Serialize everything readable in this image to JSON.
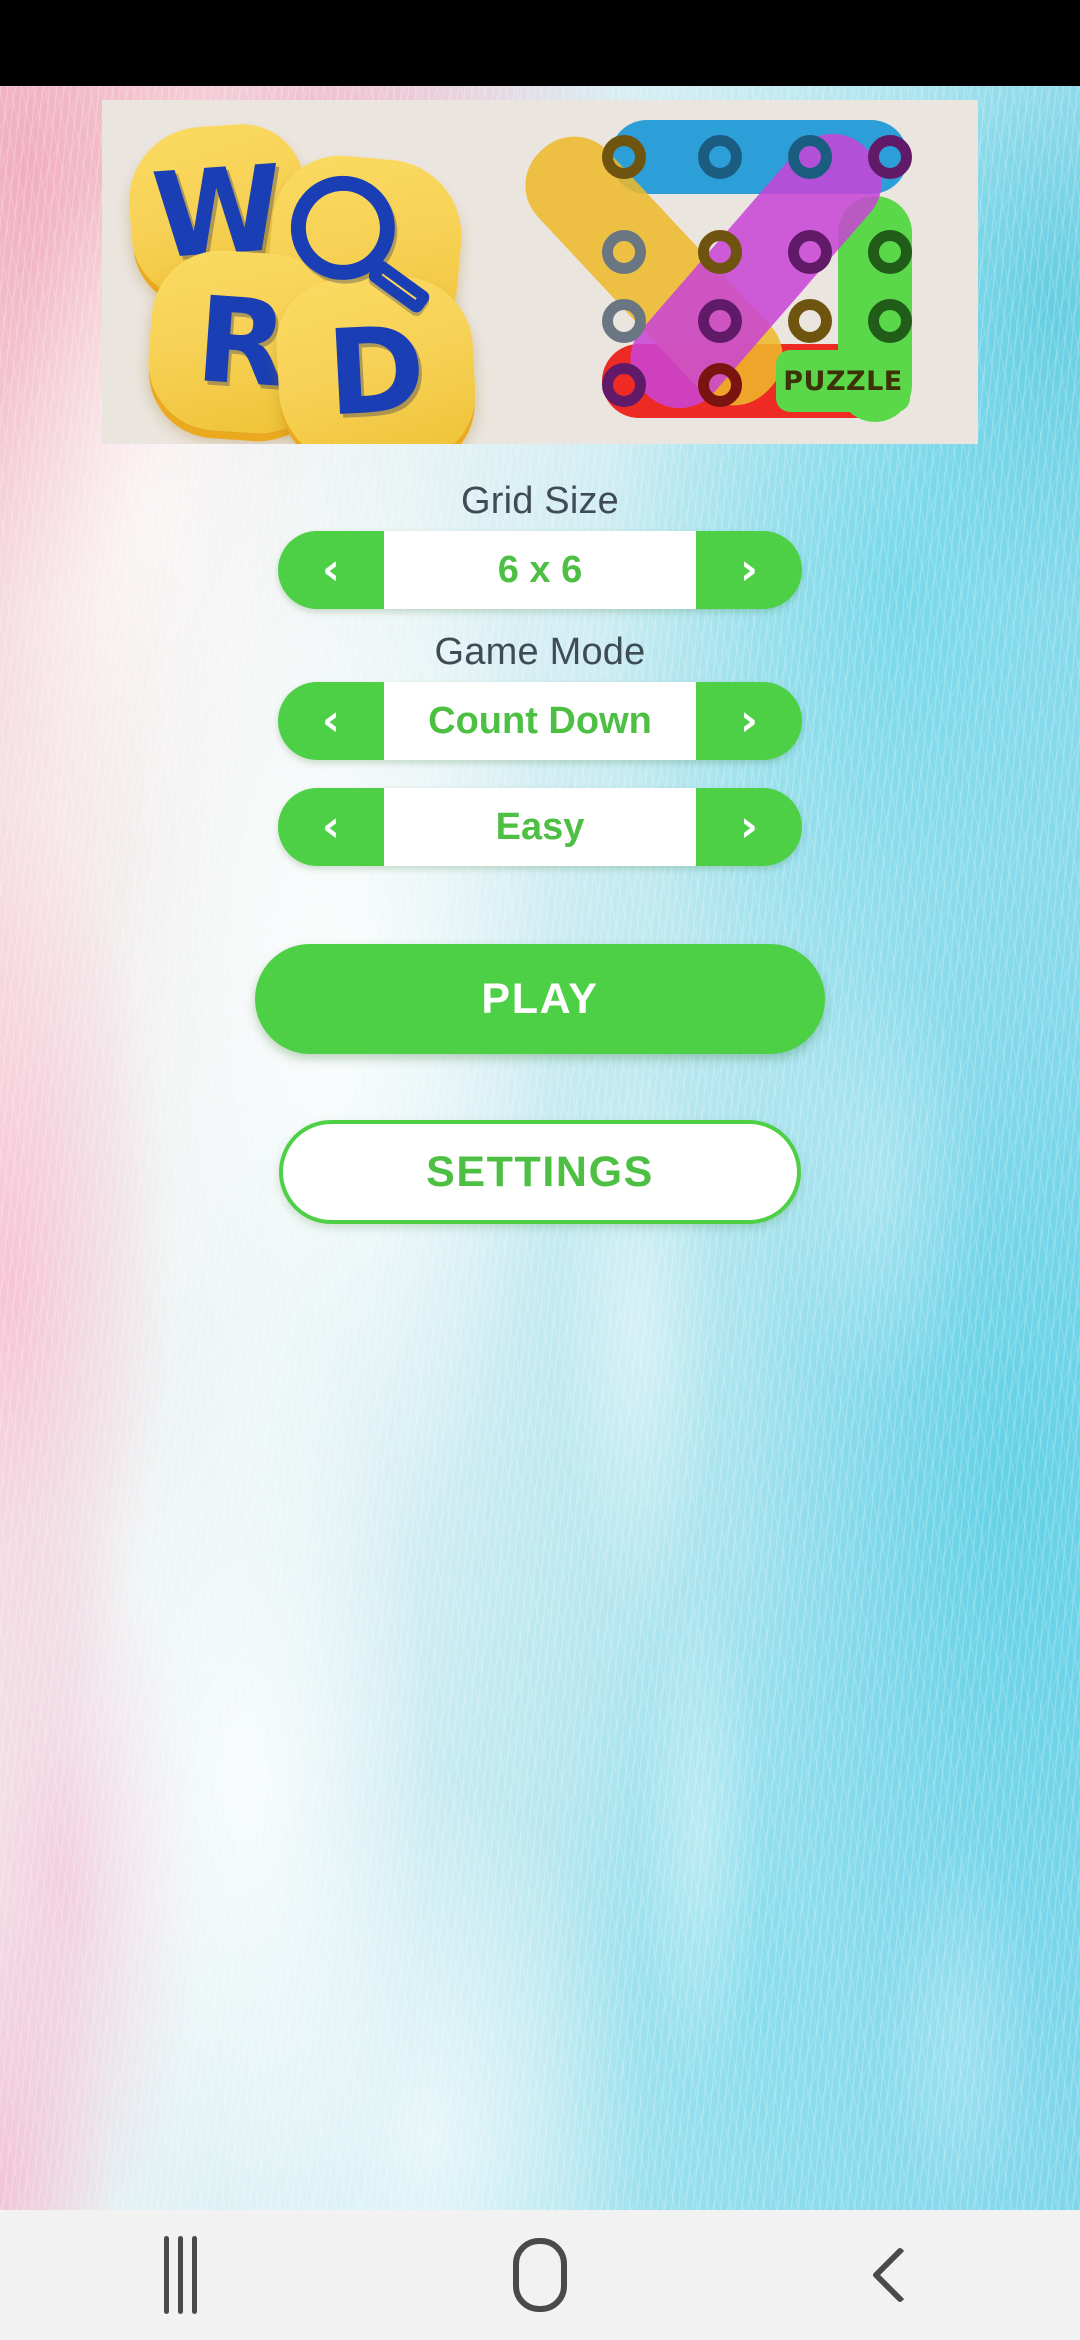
{
  "app": {
    "name": "Word Search Puzzle",
    "accent_green": "#4ed046",
    "value_green": "#4dbf43",
    "label_color": "#3f4c55"
  },
  "status_bar": {
    "background": "#000000"
  },
  "ad_banner": {
    "background": "#ebe5df",
    "word_tiles": [
      "W",
      "O",
      "R",
      "D"
    ],
    "badge_label": "PUZZLE",
    "magnifier_icon": "magnifying-glass-icon",
    "bar_colors": {
      "blue": "#2c9fd8",
      "red": "#ee2a24",
      "yellow": "#edb92a",
      "magenta": "#c843d6",
      "green": "#5ad84a"
    }
  },
  "menu": {
    "grid_size": {
      "label": "Grid Size",
      "value": "6 x 6",
      "prev_icon": "chevron-left-icon",
      "next_icon": "chevron-right-icon"
    },
    "game_mode": {
      "label": "Game Mode",
      "value": "Count Down",
      "prev_icon": "chevron-left-icon",
      "next_icon": "chevron-right-icon"
    },
    "difficulty": {
      "value": "Easy",
      "prev_icon": "chevron-left-icon",
      "next_icon": "chevron-right-icon"
    },
    "play_label": "PLAY",
    "settings_label": "SETTINGS"
  },
  "nav_bar": {
    "background": "#f2f2f2",
    "recents_icon": "recents-icon",
    "home_icon": "home-icon",
    "back_icon": "back-icon"
  },
  "icons": {
    "chevron_left": "‹",
    "chevron_right": "›"
  }
}
